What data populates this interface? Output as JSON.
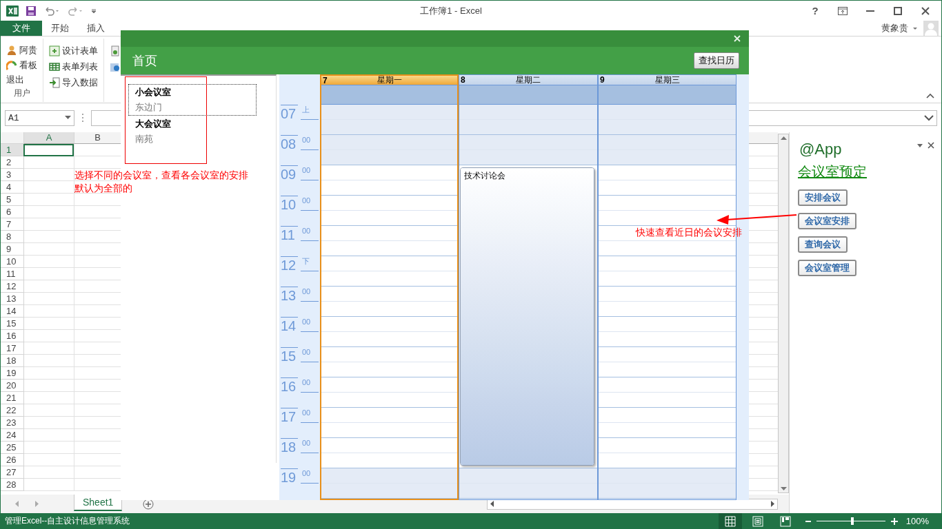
{
  "title_bar": {
    "title": "工作簿1 - Excel",
    "help": "?"
  },
  "ribbon_tabs": [
    {
      "label": "文件",
      "kind": "file",
      "selected": false
    },
    {
      "label": "开始",
      "kind": "tab",
      "selected": false
    },
    {
      "label": "插入",
      "kind": "tab",
      "selected": false
    }
  ],
  "user": {
    "name": "黄象贵"
  },
  "ribbon_groups": [
    {
      "label": "用户",
      "items": [
        {
          "label": "阿贵"
        },
        {
          "label": "看板"
        },
        {
          "label": "退出"
        }
      ]
    },
    {
      "items": [
        {
          "label": "设计表单"
        },
        {
          "label": "表单列表"
        },
        {
          "label": "导入数据"
        }
      ]
    }
  ],
  "name_box": {
    "value": "A1"
  },
  "sheet": {
    "columns": [
      {
        "label": "A",
        "selected": true
      },
      {
        "label": "B",
        "selected": false
      }
    ],
    "rows": [
      {
        "number": "1",
        "selected": true
      },
      {
        "number": "2",
        "selected": false
      },
      {
        "number": "3",
        "selected": false
      },
      {
        "number": "4",
        "selected": false
      },
      {
        "number": "5",
        "selected": false
      },
      {
        "number": "6",
        "selected": false
      },
      {
        "number": "7",
        "selected": false
      },
      {
        "number": "8",
        "selected": false
      },
      {
        "number": "9",
        "selected": false
      },
      {
        "number": "10",
        "selected": false
      },
      {
        "number": "11",
        "selected": false
      },
      {
        "number": "12",
        "selected": false
      },
      {
        "number": "13",
        "selected": false
      },
      {
        "number": "14",
        "selected": false
      },
      {
        "number": "15",
        "selected": false
      },
      {
        "number": "16",
        "selected": false
      },
      {
        "number": "17",
        "selected": false
      },
      {
        "number": "18",
        "selected": false
      },
      {
        "number": "19",
        "selected": false
      },
      {
        "number": "20",
        "selected": false
      },
      {
        "number": "21",
        "selected": false
      },
      {
        "number": "22",
        "selected": false
      },
      {
        "number": "23",
        "selected": false
      },
      {
        "number": "24",
        "selected": false
      },
      {
        "number": "25",
        "selected": false
      },
      {
        "number": "26",
        "selected": false
      },
      {
        "number": "27",
        "selected": false
      },
      {
        "number": "28",
        "selected": false
      }
    ]
  },
  "sheet_tabs": [
    {
      "label": "Sheet1",
      "selected": true
    }
  ],
  "task_pane": {
    "title": "@App",
    "link": "会议室预定",
    "buttons": [
      "安排会议",
      "会议室安排",
      "查询会议",
      "会议室管理"
    ]
  },
  "status_bar": {
    "text": "管理Excel--自主设计信息管理系统",
    "views": [
      {
        "kind": "normal",
        "selected": true
      },
      {
        "kind": "layout",
        "selected": false
      },
      {
        "kind": "pagebreak",
        "selected": false
      }
    ],
    "zoom": {
      "level": 0.5,
      "reading": "100%"
    }
  },
  "dialog": {
    "title": "首页",
    "button": "查找日历",
    "rooms": [
      {
        "name": "小会议室",
        "location": "东边门",
        "selected": true
      },
      {
        "name": "大会议室",
        "location": "南苑",
        "selected": false
      }
    ],
    "calendar": {
      "days": [
        {
          "day": "7",
          "weekday": "星期一",
          "selected": true,
          "slots": [
            {
              "booked": false
            },
            {
              "booked": false
            },
            {
              "booked": false
            },
            {
              "booked": false
            },
            {
              "booked": false
            },
            {
              "booked": false
            },
            {
              "booked": false
            },
            {
              "booked": false
            },
            {
              "booked": false
            },
            {
              "booked": false
            },
            {
              "booked": false
            },
            {
              "booked": false
            },
            {
              "booked": false
            }
          ]
        },
        {
          "day": "8",
          "weekday": "星期二",
          "selected": false,
          "event": {
            "title": "技术讨论会"
          },
          "slots": [
            {
              "booked": false
            },
            {
              "booked": false
            },
            {
              "booked": true
            },
            {
              "booked": true
            },
            {
              "booked": true
            },
            {
              "booked": true
            },
            {
              "booked": true
            },
            {
              "booked": true
            },
            {
              "booked": true
            },
            {
              "booked": true
            },
            {
              "booked": true
            },
            {
              "booked": true
            },
            {
              "booked": false
            }
          ]
        },
        {
          "day": "9",
          "weekday": "星期三",
          "selected": false,
          "slots": [
            {
              "booked": false
            },
            {
              "booked": false
            },
            {
              "booked": false
            },
            {
              "booked": false
            },
            {
              "booked": false
            },
            {
              "booked": false
            },
            {
              "booked": false
            },
            {
              "booked": false
            },
            {
              "booked": false
            },
            {
              "booked": false
            },
            {
              "booked": false
            },
            {
              "booked": false
            },
            {
              "booked": false
            }
          ]
        }
      ],
      "hours": [
        {
          "hour": "07",
          "minute": "上",
          "shaded": true
        },
        {
          "hour": "08",
          "minute": "00",
          "shaded": true
        },
        {
          "hour": "09",
          "minute": "00",
          "shaded": false
        },
        {
          "hour": "10",
          "minute": "00",
          "shaded": false
        },
        {
          "hour": "11",
          "minute": "00",
          "shaded": false
        },
        {
          "hour": "12",
          "minute": "下",
          "shaded": false
        },
        {
          "hour": "13",
          "minute": "00",
          "shaded": false
        },
        {
          "hour": "14",
          "minute": "00",
          "shaded": false
        },
        {
          "hour": "15",
          "minute": "00",
          "shaded": false
        },
        {
          "hour": "16",
          "minute": "00",
          "shaded": false
        },
        {
          "hour": "17",
          "minute": "00",
          "shaded": false
        },
        {
          "hour": "18",
          "minute": "00",
          "shaded": false
        },
        {
          "hour": "19",
          "minute": "00",
          "shaded": true
        }
      ]
    }
  },
  "annotations": [
    {
      "kind": "box"
    },
    {
      "kind": "note",
      "lines": [
        "选择不同的会议室，查看各会议室的安排",
        "默认为全部的"
      ]
    },
    {
      "kind": "arrow"
    },
    {
      "kind": "note",
      "lines": [
        "快速查看近日的会议安排"
      ]
    }
  ]
}
